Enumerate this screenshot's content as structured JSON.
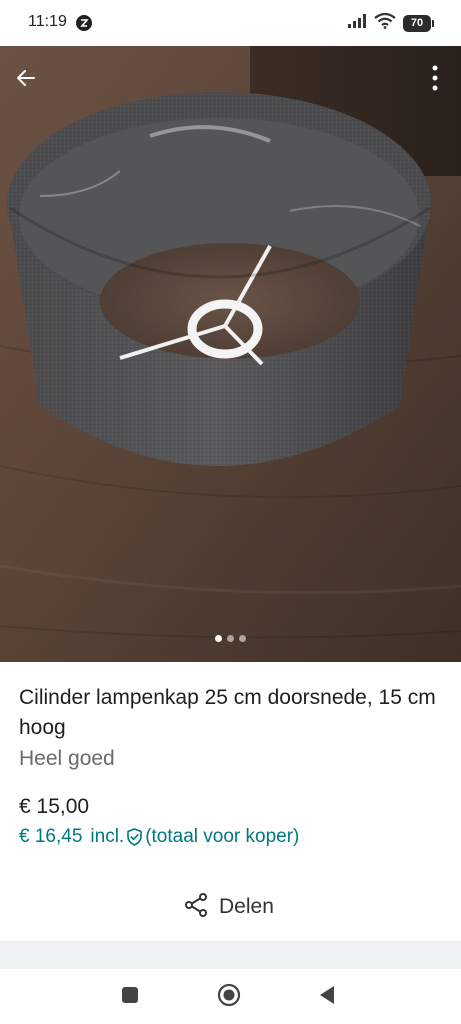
{
  "status_bar": {
    "time": "11:19",
    "battery": "70"
  },
  "product": {
    "title": "Cilinder lampenkap 25 cm doorsnede, 15 cm hoog",
    "condition": "Heel goed",
    "price": "€ 15,00",
    "price_incl_amount": "€ 16,45",
    "price_incl_label": "incl.",
    "price_incl_note": "(totaal voor koper)"
  },
  "gallery": {
    "photo_count": 3,
    "active_index": 0
  },
  "actions": {
    "share_label": "Delen"
  },
  "icons": {
    "back": "arrow-left-icon",
    "more": "more-vertical-icon",
    "share": "share-icon",
    "shield": "shield-check-icon",
    "nav_recents": "square-icon",
    "nav_home": "circle-icon",
    "nav_back": "triangle-back-icon"
  },
  "colors": {
    "accent": "#007782",
    "text": "#1f1f1f",
    "muted": "#6b6b6b"
  }
}
